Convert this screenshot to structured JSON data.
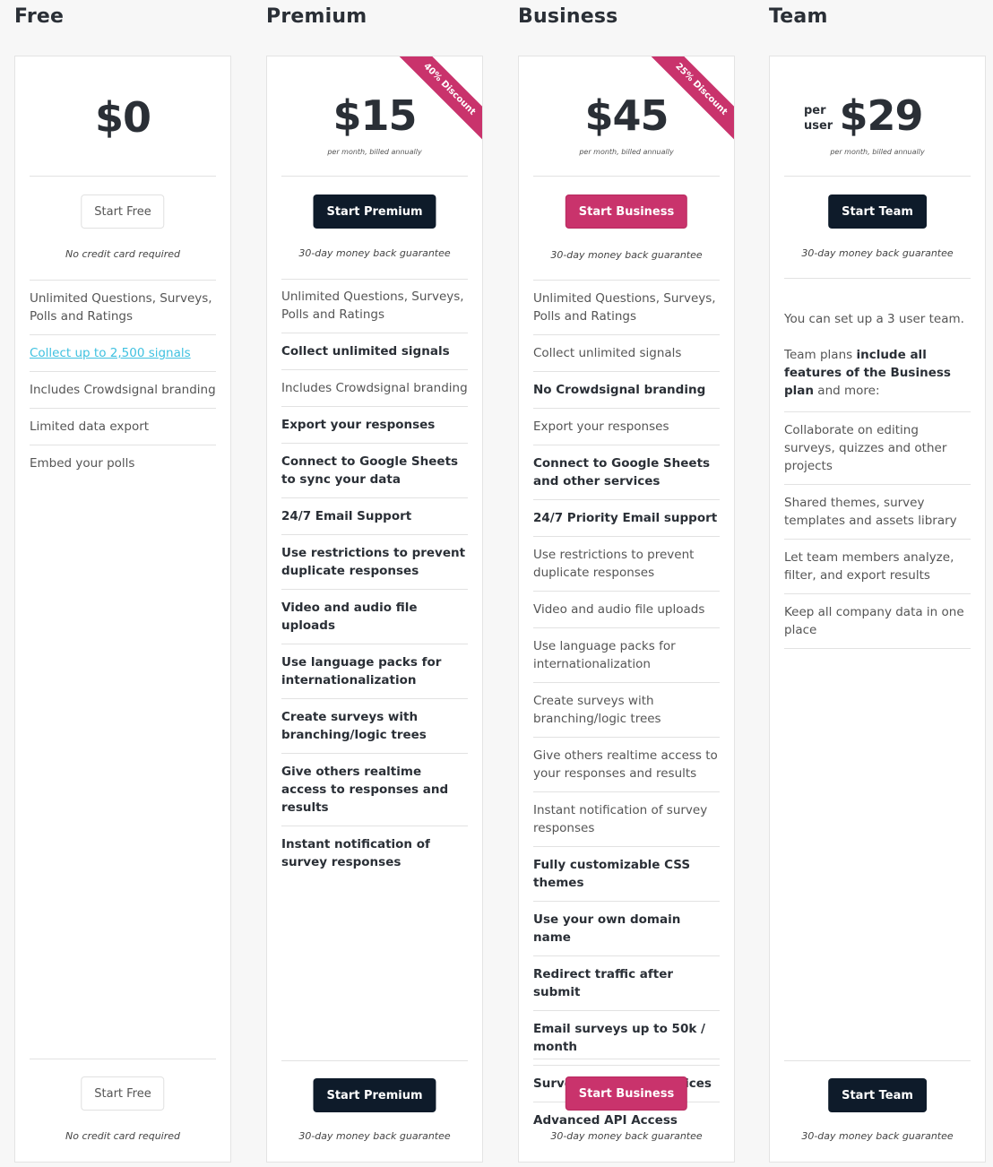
{
  "plans": [
    {
      "title": "Free",
      "price": "$0",
      "price_note": "",
      "cta_label": "Start Free",
      "cta_note": "No credit card required",
      "features": [
        {
          "text": "Unlimited Questions, Surveys, Polls and Ratings",
          "style": "normal"
        },
        {
          "text": "Collect up to 2,500 signals",
          "style": "link"
        },
        {
          "text": "Includes Crowdsignal branding",
          "style": "normal"
        },
        {
          "text": "Limited data export",
          "style": "normal"
        },
        {
          "text": "Embed your polls",
          "style": "normal"
        }
      ]
    },
    {
      "title": "Premium",
      "price": "$15",
      "price_note": "per month, billed annually",
      "ribbon": "40% Discount",
      "cta_label": "Start Premium",
      "cta_note": "30-day money back guarantee",
      "features": [
        {
          "text": "Unlimited Questions, Surveys, Polls and Ratings",
          "style": "normal"
        },
        {
          "text": "Collect unlimited signals",
          "style": "bold"
        },
        {
          "text": "Includes Crowdsignal branding",
          "style": "normal"
        },
        {
          "text": "Export your responses",
          "style": "bold"
        },
        {
          "text": "Connect to Google Sheets to sync your data",
          "style": "bold"
        },
        {
          "text": "24/7 Email Support",
          "style": "bold"
        },
        {
          "text": "Use restrictions to prevent duplicate responses",
          "style": "bold"
        },
        {
          "text": "Video and audio file uploads",
          "style": "bold"
        },
        {
          "text": "Use language packs for internationalization",
          "style": "bold"
        },
        {
          "text": "Create surveys with branching/logic trees",
          "style": "bold"
        },
        {
          "text": "Give others realtime access to responses and results",
          "style": "bold"
        },
        {
          "text": "Instant notification of survey responses",
          "style": "bold"
        }
      ]
    },
    {
      "title": "Business",
      "price": "$45",
      "price_note": "per month, billed annually",
      "ribbon": "25% Discount",
      "cta_label": "Start Business",
      "cta_note": "30-day money back guarantee",
      "features": [
        {
          "text": "Unlimited Questions, Surveys, Polls and Ratings",
          "style": "normal"
        },
        {
          "text": "Collect unlimited signals",
          "style": "normal"
        },
        {
          "text": "No Crowdsignal branding",
          "style": "bold"
        },
        {
          "text": "Export your responses",
          "style": "normal"
        },
        {
          "text": "Connect to Google Sheets and other services",
          "style": "bold"
        },
        {
          "text": "24/7 Priority Email support",
          "style": "bold"
        },
        {
          "text": "Use restrictions to prevent duplicate responses",
          "style": "normal"
        },
        {
          "text": "Video and audio file uploads",
          "style": "normal"
        },
        {
          "text": "Use language packs for internationalization",
          "style": "normal"
        },
        {
          "text": "Create surveys with branching/logic trees",
          "style": "normal"
        },
        {
          "text": "Give others realtime access to your responses and results",
          "style": "normal"
        },
        {
          "text": "Instant notification of survey responses",
          "style": "normal"
        },
        {
          "text": "Fully customizable CSS themes",
          "style": "bold"
        },
        {
          "text": "Use your own domain name",
          "style": "bold"
        },
        {
          "text": "Redirect traffic after submit",
          "style": "bold"
        },
        {
          "text": "Email surveys up to 50k / month",
          "style": "bold"
        },
        {
          "text": "Surveys on offline devices",
          "style": "bold"
        },
        {
          "text": "Advanced API Access",
          "style": "bold"
        }
      ]
    },
    {
      "title": "Team",
      "price": "$29",
      "price_prefix": "per user",
      "price_note": "per month, billed annually",
      "cta_label": "Start Team",
      "cta_note": "30-day money back guarantee",
      "intro_line": "You can set up a 3 user team.",
      "intro_pre": "Team plans ",
      "intro_bold": "include all features of the Business plan",
      "intro_post": " and more:",
      "features": [
        {
          "text": "Collaborate on editing surveys, quizzes and other projects",
          "style": "normal"
        },
        {
          "text": "Shared themes, survey templates and assets library",
          "style": "normal"
        },
        {
          "text": "Let team members analyze, filter, and export results",
          "style": "normal"
        },
        {
          "text": "Keep all company data in one place",
          "style": "normal"
        }
      ]
    }
  ],
  "colors": {
    "accent_pink": "#c9336c",
    "dark_navy": "#0e1b2a",
    "link_cyan": "#3fc1e0"
  }
}
